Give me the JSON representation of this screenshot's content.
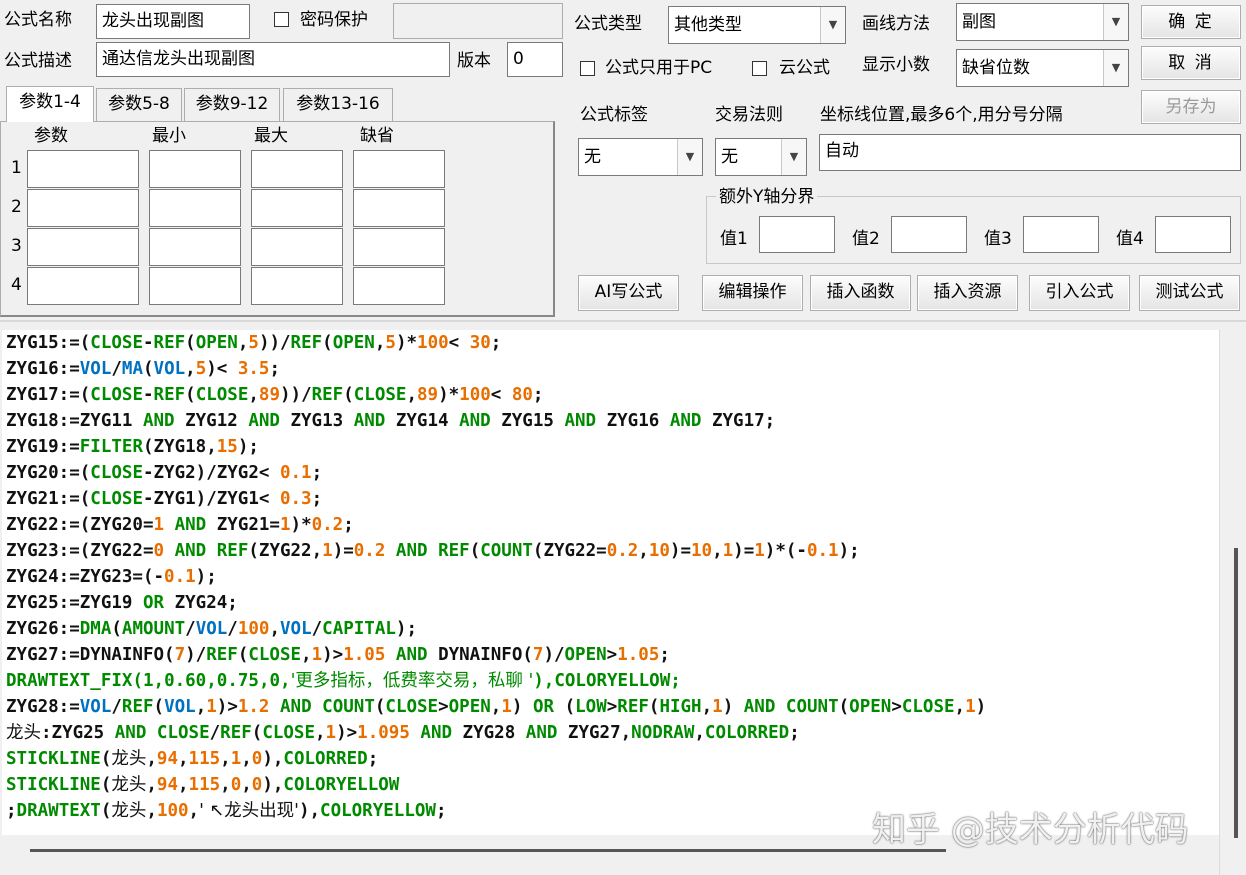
{
  "form": {
    "name_label": "公式名称",
    "name_value": "龙头出现副图",
    "password_label": "密码保护",
    "desc_label": "公式描述",
    "desc_value": "通达信龙头出现副图",
    "version_label": "版本",
    "version_value": "0",
    "type_label": "公式类型",
    "type_value": "其他类型",
    "draw_label": "画线方法",
    "draw_value": "副图",
    "pc_only_label": "公式只用于PC",
    "cloud_label": "云公式",
    "decimal_label": "显示小数",
    "decimal_value": "缺省位数",
    "tag_label": "公式标签",
    "tag_value": "无",
    "rule_label": "交易法则",
    "rule_value": "无",
    "coord_label": "坐标线位置,最多6个,用分号分隔",
    "coord_value": "自动",
    "extra_y_label": "额外Y轴分界",
    "val_labels": [
      "值1",
      "值2",
      "值3",
      "值4"
    ]
  },
  "buttons": {
    "ok": "确 定",
    "cancel": "取 消",
    "save_as": "另存为",
    "ai": "AI写公式",
    "edit": "编辑操作",
    "insert_func": "插入函数",
    "insert_res": "插入资源",
    "import": "引入公式",
    "test": "测试公式"
  },
  "tabs": [
    "参数1-4",
    "参数5-8",
    "参数9-12",
    "参数13-16"
  ],
  "param_headers": [
    "参数",
    "最小",
    "最大",
    "缺省"
  ],
  "param_rows": [
    "1",
    "2",
    "3",
    "4"
  ],
  "code_lines": [
    "ZYG15:=(CLOSE-REF(OPEN,5))/REF(OPEN,5)*100< 30;",
    "ZYG16:=VOL/MA(VOL,5)< 3.5;",
    "ZYG17:=(CLOSE-REF(CLOSE,89))/REF(CLOSE,89)*100< 80;",
    "ZYG18:=ZYG11 AND ZYG12 AND ZYG13 AND ZYG14 AND ZYG15 AND ZYG16 AND ZYG17;",
    "ZYG19:=FILTER(ZYG18,15);",
    "ZYG20:=(CLOSE-ZYG2)/ZYG2< 0.1;",
    "ZYG21:=(CLOSE-ZYG1)/ZYG1< 0.3;",
    "ZYG22:=(ZYG20=1 AND ZYG21=1)*0.2;",
    "ZYG23:=(ZYG22=0 AND REF(ZYG22,1)=0.2 AND REF(COUNT(ZYG22=0.2,10)=10,1)=1)*(-0.1);",
    "ZYG24:=ZYG23=(-0.1);",
    "ZYG25:=ZYG19 OR ZYG24;",
    "ZYG26:=DMA(AMOUNT/VOL/100,VOL/CAPITAL);",
    "ZYG27:=DYNAINFO(7)/REF(CLOSE,1)>1.05 AND DYNAINFO(7)/OPEN>1.05;",
    "DRAWTEXT_FIX(1,0.60,0.75,0,'更多指标，低费率交易，私聊 '),COLORYELLOW;",
    "ZYG28:=VOL/REF(VOL,1)>1.2 AND COUNT(CLOSE>OPEN,1) OR (LOW>REF(HIGH,1) AND COUNT(OPEN>CLOSE,1)",
    "龙头:ZYG25 AND CLOSE/REF(CLOSE,1)>1.095 AND ZYG28 AND ZYG27,NODRAW,COLORRED;",
    "STICKLINE(龙头,94,115,1,0),COLORRED;",
    "STICKLINE(龙头,94,115,0,0),COLORYELLOW",
    ";DRAWTEXT(龙头,100,' ↖龙头出现'),COLORYELLOW;"
  ],
  "watermark": "知乎 @技术分析代码",
  "colors": {
    "keyword_green": "#008a00",
    "keyword_blue": "#0070c0",
    "number_orange": "#e86e00"
  }
}
